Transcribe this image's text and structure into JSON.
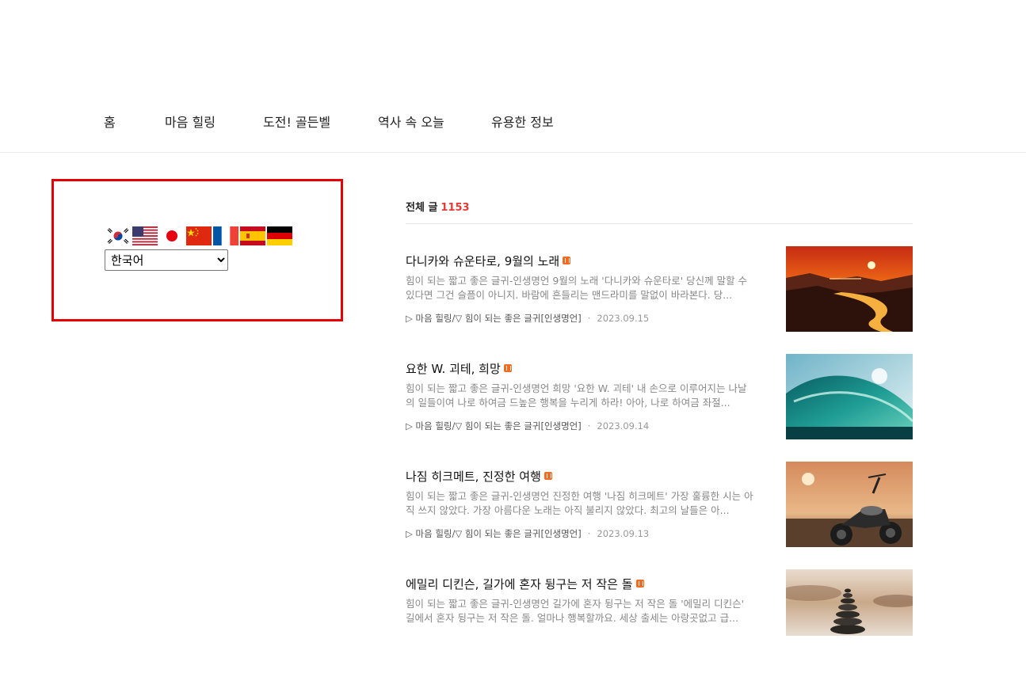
{
  "nav": {
    "items": [
      "홈",
      "마음 힐링",
      "도전! 골든벨",
      "역사 속 오늘",
      "유용한 정보"
    ]
  },
  "language": {
    "flags": [
      "korea-flag",
      "usa-flag",
      "japan-flag",
      "china-flag",
      "france-flag",
      "spain-flag",
      "germany-flag"
    ],
    "selected": "한국어",
    "highlight_color": "#e60000"
  },
  "list": {
    "total_label": "전체 글",
    "total_count": "1153",
    "accent_color": "#e53935"
  },
  "posts": [
    {
      "title": "다니카와 슈운타로, 9월의 노래",
      "summary": "힘이 되는 짧고 좋은 글귀-인생명언 9월의 노래 '다니카와 슈운타로' 당신께 말할 수 있다면 그건 슬픔이 아니지. 바람에 흔들리는 맨드라미를 말없이 바라본다. 당...",
      "category": "▷ 마음 힐링/▽ 힘이 되는 좋은 글귀[인생명언]",
      "date": "2023.09.15",
      "thumbnail": "sunset-river"
    },
    {
      "title": "요한 W. 괴테, 희망",
      "summary": "힘이 되는 짧고 좋은 글귀-인생명언 희망 '요한 W. 괴테' 내 손으로 이루어지는 나날의 일들이여 나로 하여금 드높은 행복을 누리게 하라! 아아, 나로 하여금 좌절...",
      "category": "▷ 마음 힐링/▽ 힘이 되는 좋은 글귀[인생명언]",
      "date": "2023.09.14",
      "thumbnail": "ocean-wave"
    },
    {
      "title": "나짐 히크메트, 진정한 여행",
      "summary": "힘이 되는 짧고 좋은 글귀-인생명언 진정한 여행 '나짐 히크메트' 가장 훌륭한 시는 아직 쓰지 않았다. 가장 아름다운 노래는 아직 불리지 않았다. 최고의 날들은 아...",
      "category": "▷ 마음 힐링/▽ 힘이 되는 좋은 글귀[인생명언]",
      "date": "2023.09.13",
      "thumbnail": "motorcycle-sunset"
    },
    {
      "title": "에밀리 디킨슨, 길가에 혼자 뒹구는 저 작은 돌",
      "summary": "힘이 되는 짧고 좋은 글귀-인생명언 길가에 혼자 뒹구는 저 작은 돌 '에밀리 디킨슨' 길에서 혼자 뒹구는 저 작은 돌. 얼마나 행복할까요. 세상 출세는 아랑곳없고 급...",
      "category": "",
      "date": "",
      "thumbnail": "stacked-stones"
    }
  ]
}
